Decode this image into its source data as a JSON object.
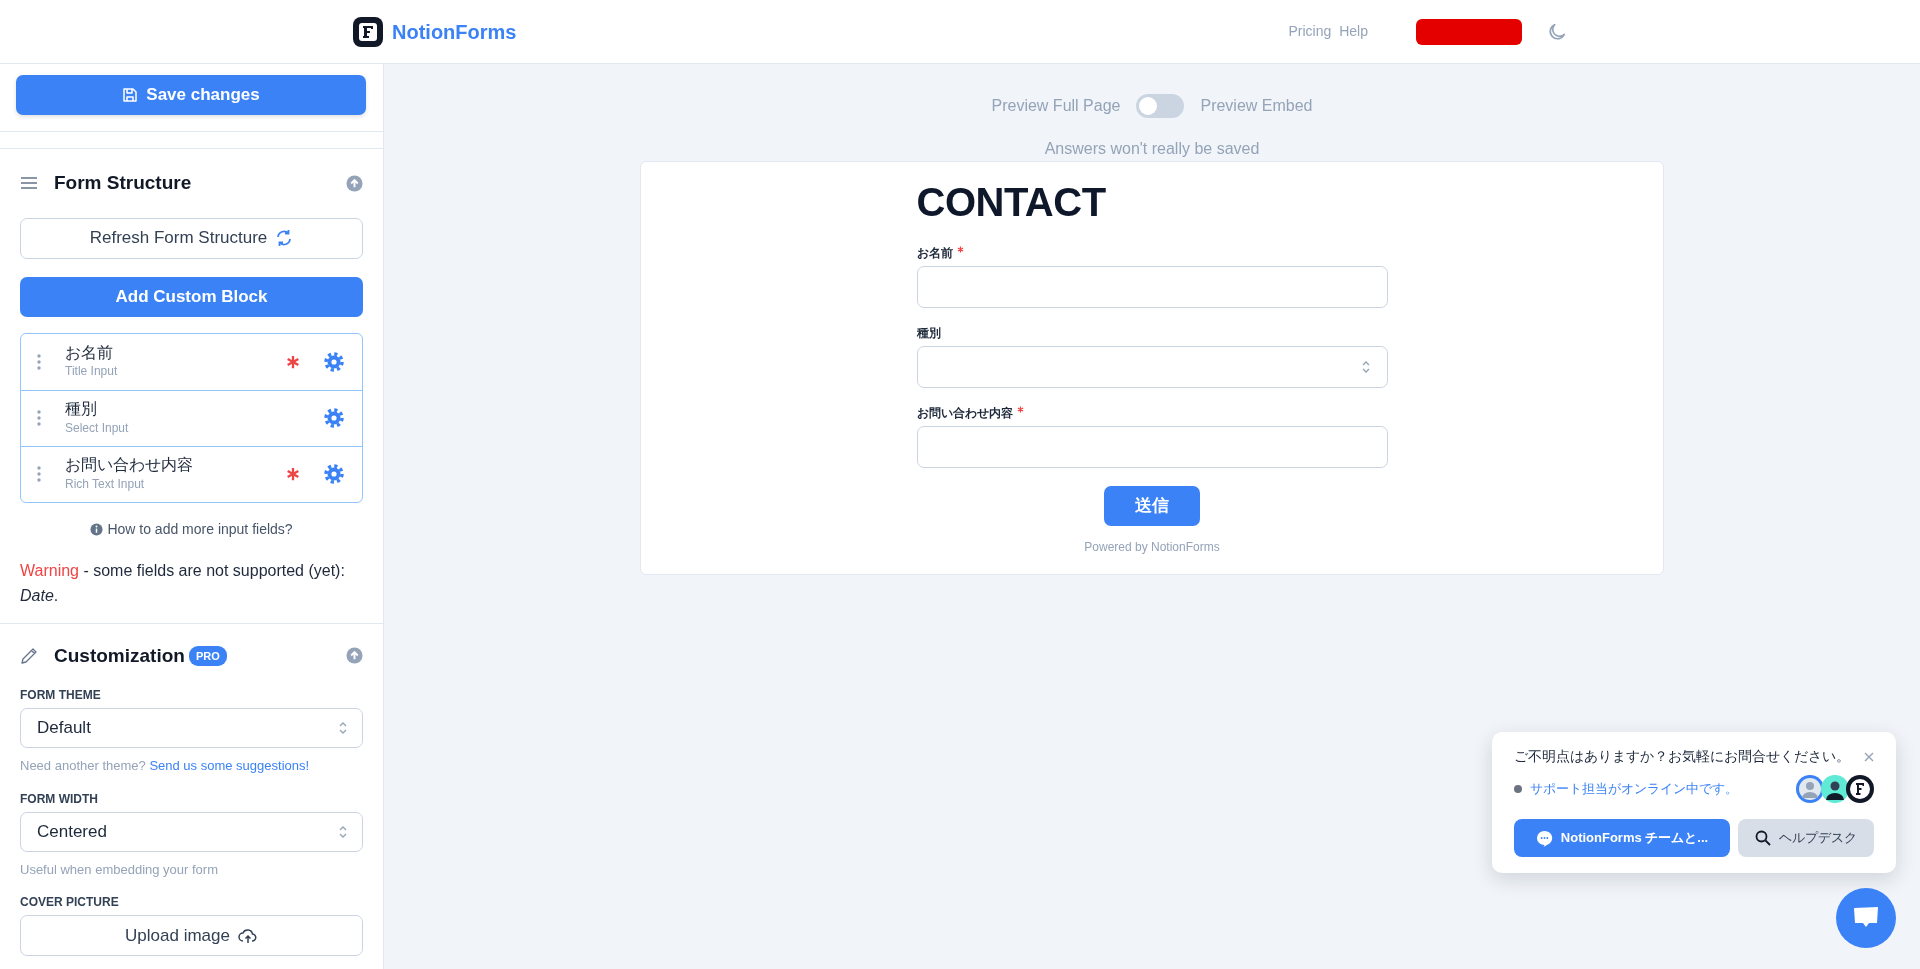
{
  "header": {
    "brand": "NotionForms",
    "nav": [
      "Pricing",
      "Help"
    ]
  },
  "sidebar": {
    "save_button": "Save changes",
    "form_structure": {
      "title": "Form Structure",
      "refresh_button": "Refresh Form Structure",
      "add_button": "Add Custom Block",
      "fields": [
        {
          "name": "お名前",
          "type": "Title Input",
          "required": true
        },
        {
          "name": "種別",
          "type": "Select Input",
          "required": false
        },
        {
          "name": "お問い合わせ内容",
          "type": "Rich Text Input",
          "required": true
        }
      ],
      "help_link": "How to add more input fields?",
      "warning": {
        "label": "Warning",
        "text": "- some fields are not supported (yet): *Date*."
      }
    },
    "customization": {
      "title": "Customization",
      "badge": "PRO",
      "settings": [
        {
          "kind": "select",
          "label": "FORM THEME",
          "value": "Default",
          "hint": "Need another theme?",
          "hint_link": "Send us some suggestions!"
        },
        {
          "kind": "select",
          "label": "FORM WIDTH",
          "value": "Centered",
          "hint": "Useful when embedding your form"
        },
        {
          "kind": "upload",
          "label": "COVER PICTURE",
          "button": "Upload image"
        }
      ]
    }
  },
  "preview": {
    "left_label": "Preview Full Page",
    "right_label": "Preview Embed",
    "embed_on": false,
    "note": "Answers won't really be saved"
  },
  "form": {
    "title": "CONTACT",
    "fields": [
      {
        "kind": "text",
        "label": "お名前",
        "required": true
      },
      {
        "kind": "select",
        "label": "種別",
        "required": false
      },
      {
        "kind": "text",
        "label": "お問い合わせ内容",
        "required": true
      }
    ],
    "submit": "送信",
    "footer": "Powered by NotionForms"
  },
  "chat": {
    "message": "ご不明点はありますか？お気軽にお問合せください。",
    "status": "サポート担当がオンライン中です。",
    "chat_button": "NotionForms チームと...",
    "helpdesk_button": "ヘルプデスク"
  }
}
